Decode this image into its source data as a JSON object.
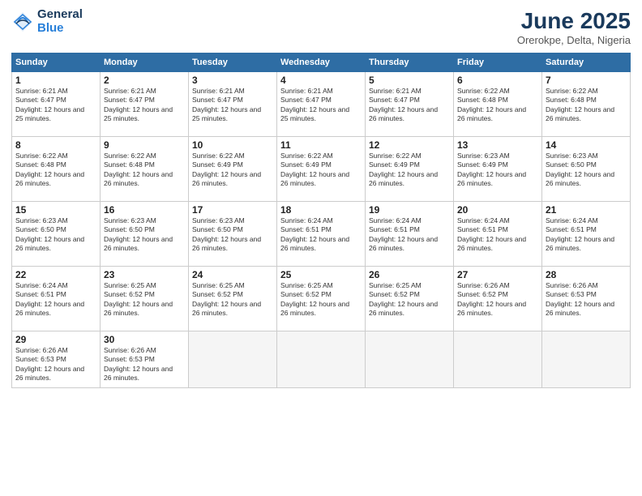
{
  "logo": {
    "general": "General",
    "blue": "Blue"
  },
  "title": "June 2025",
  "subtitle": "Orerokpe, Delta, Nigeria",
  "days_header": [
    "Sunday",
    "Monday",
    "Tuesday",
    "Wednesday",
    "Thursday",
    "Friday",
    "Saturday"
  ],
  "weeks": [
    [
      {
        "num": "1",
        "rise": "6:21 AM",
        "set": "6:47 PM",
        "daylight": "12 hours and 25 minutes."
      },
      {
        "num": "2",
        "rise": "6:21 AM",
        "set": "6:47 PM",
        "daylight": "12 hours and 25 minutes."
      },
      {
        "num": "3",
        "rise": "6:21 AM",
        "set": "6:47 PM",
        "daylight": "12 hours and 25 minutes."
      },
      {
        "num": "4",
        "rise": "6:21 AM",
        "set": "6:47 PM",
        "daylight": "12 hours and 25 minutes."
      },
      {
        "num": "5",
        "rise": "6:21 AM",
        "set": "6:47 PM",
        "daylight": "12 hours and 26 minutes."
      },
      {
        "num": "6",
        "rise": "6:22 AM",
        "set": "6:48 PM",
        "daylight": "12 hours and 26 minutes."
      },
      {
        "num": "7",
        "rise": "6:22 AM",
        "set": "6:48 PM",
        "daylight": "12 hours and 26 minutes."
      }
    ],
    [
      {
        "num": "8",
        "rise": "6:22 AM",
        "set": "6:48 PM",
        "daylight": "12 hours and 26 minutes."
      },
      {
        "num": "9",
        "rise": "6:22 AM",
        "set": "6:48 PM",
        "daylight": "12 hours and 26 minutes."
      },
      {
        "num": "10",
        "rise": "6:22 AM",
        "set": "6:49 PM",
        "daylight": "12 hours and 26 minutes."
      },
      {
        "num": "11",
        "rise": "6:22 AM",
        "set": "6:49 PM",
        "daylight": "12 hours and 26 minutes."
      },
      {
        "num": "12",
        "rise": "6:22 AM",
        "set": "6:49 PM",
        "daylight": "12 hours and 26 minutes."
      },
      {
        "num": "13",
        "rise": "6:23 AM",
        "set": "6:49 PM",
        "daylight": "12 hours and 26 minutes."
      },
      {
        "num": "14",
        "rise": "6:23 AM",
        "set": "6:50 PM",
        "daylight": "12 hours and 26 minutes."
      }
    ],
    [
      {
        "num": "15",
        "rise": "6:23 AM",
        "set": "6:50 PM",
        "daylight": "12 hours and 26 minutes."
      },
      {
        "num": "16",
        "rise": "6:23 AM",
        "set": "6:50 PM",
        "daylight": "12 hours and 26 minutes."
      },
      {
        "num": "17",
        "rise": "6:23 AM",
        "set": "6:50 PM",
        "daylight": "12 hours and 26 minutes."
      },
      {
        "num": "18",
        "rise": "6:24 AM",
        "set": "6:51 PM",
        "daylight": "12 hours and 26 minutes."
      },
      {
        "num": "19",
        "rise": "6:24 AM",
        "set": "6:51 PM",
        "daylight": "12 hours and 26 minutes."
      },
      {
        "num": "20",
        "rise": "6:24 AM",
        "set": "6:51 PM",
        "daylight": "12 hours and 26 minutes."
      },
      {
        "num": "21",
        "rise": "6:24 AM",
        "set": "6:51 PM",
        "daylight": "12 hours and 26 minutes."
      }
    ],
    [
      {
        "num": "22",
        "rise": "6:24 AM",
        "set": "6:51 PM",
        "daylight": "12 hours and 26 minutes."
      },
      {
        "num": "23",
        "rise": "6:25 AM",
        "set": "6:52 PM",
        "daylight": "12 hours and 26 minutes."
      },
      {
        "num": "24",
        "rise": "6:25 AM",
        "set": "6:52 PM",
        "daylight": "12 hours and 26 minutes."
      },
      {
        "num": "25",
        "rise": "6:25 AM",
        "set": "6:52 PM",
        "daylight": "12 hours and 26 minutes."
      },
      {
        "num": "26",
        "rise": "6:25 AM",
        "set": "6:52 PM",
        "daylight": "12 hours and 26 minutes."
      },
      {
        "num": "27",
        "rise": "6:26 AM",
        "set": "6:52 PM",
        "daylight": "12 hours and 26 minutes."
      },
      {
        "num": "28",
        "rise": "6:26 AM",
        "set": "6:53 PM",
        "daylight": "12 hours and 26 minutes."
      }
    ],
    [
      {
        "num": "29",
        "rise": "6:26 AM",
        "set": "6:53 PM",
        "daylight": "12 hours and 26 minutes."
      },
      {
        "num": "30",
        "rise": "6:26 AM",
        "set": "6:53 PM",
        "daylight": "12 hours and 26 minutes."
      },
      null,
      null,
      null,
      null,
      null
    ]
  ]
}
